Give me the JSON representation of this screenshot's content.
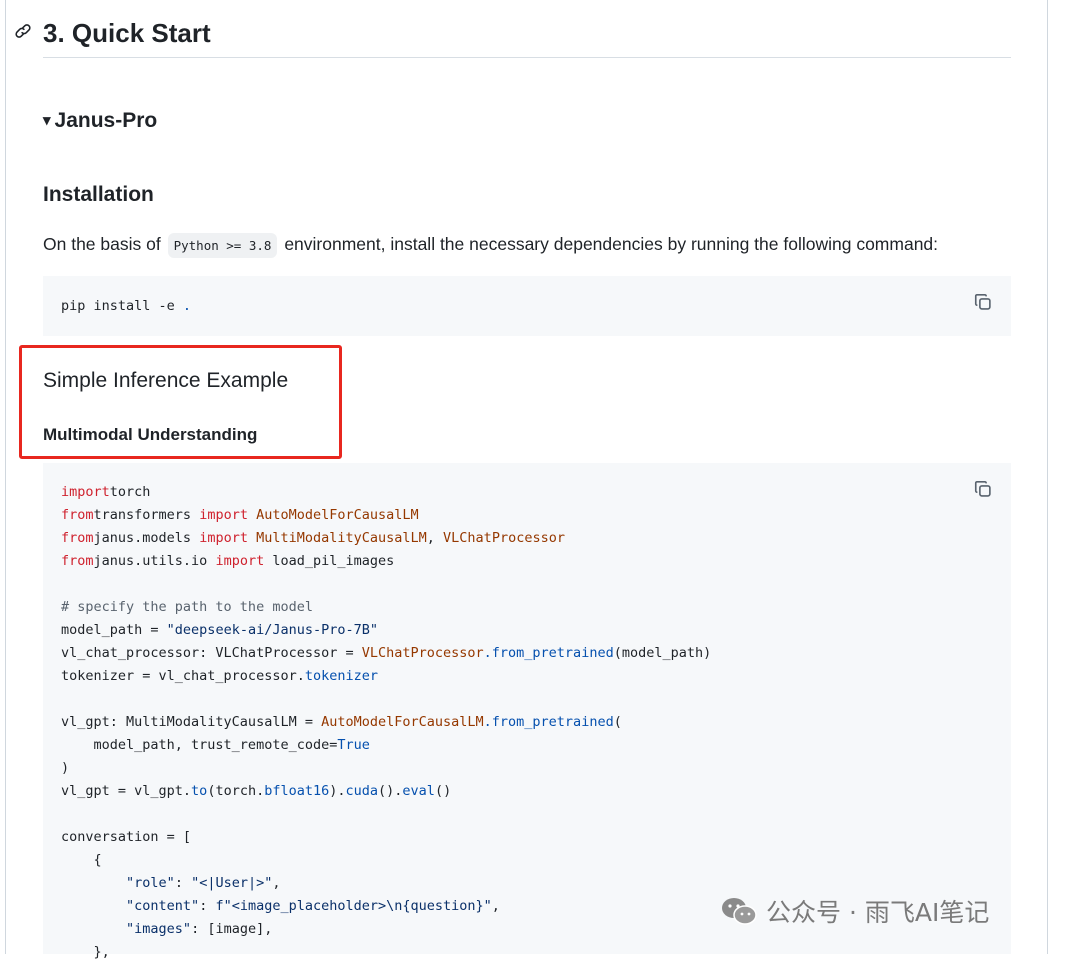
{
  "section": {
    "title": "3. Quick Start",
    "anchor_icon": "link-icon"
  },
  "details": {
    "summary": "Janus-Pro",
    "marker": "▾"
  },
  "installation": {
    "heading": "Installation",
    "text_before": "On the basis of",
    "inline_code": "Python >= 3.8",
    "text_after": "environment, install the necessary dependencies by running the following command:",
    "command_main": "pip install -e ",
    "command_dot": "."
  },
  "inference": {
    "heading": "Simple Inference Example",
    "subheading": "Multimodal Understanding"
  },
  "copy_icon": "copy-icon",
  "highlight_color": "#e8271f",
  "watermark": {
    "text": "公众号 · 雨飞AI笔记",
    "icon": "wechat-icon"
  },
  "code": [
    [
      [
        "kw",
        "import"
      ],
      [
        "",
        "torch"
      ]
    ],
    [
      [
        "kw",
        "from"
      ],
      [
        "",
        "transformers "
      ],
      [
        "kw",
        "import"
      ],
      [
        "nm",
        " AutoModelForCausalLM"
      ]
    ],
    [
      [
        "kw",
        "from"
      ],
      [
        "",
        "janus.models "
      ],
      [
        "kw",
        "import"
      ],
      [
        "nm",
        " MultiModalityCausalLM"
      ],
      [
        "",
        ", "
      ],
      [
        "nm",
        "VLChatProcessor"
      ]
    ],
    [
      [
        "kw",
        "from"
      ],
      [
        "",
        "janus.utils.io "
      ],
      [
        "kw",
        "import"
      ],
      [
        "",
        " load_pil_images"
      ]
    ],
    [],
    [
      [
        "cm",
        "# specify the path to the model"
      ]
    ],
    [
      [
        "",
        "model_path = "
      ],
      [
        "st",
        "\"deepseek-ai/Janus-Pro-7B\""
      ]
    ],
    [
      [
        "",
        "vl_chat_processor: VLChatProcessor = "
      ],
      [
        "nm",
        "VLChatProcessor"
      ],
      [
        "",
        ""
      ],
      [
        "bl",
        ".from_pretrained"
      ],
      [
        "",
        "(model_path)"
      ]
    ],
    [
      [
        "",
        "tokenizer = vl_chat_processor."
      ],
      [
        "bl",
        "tokenizer"
      ]
    ],
    [],
    [
      [
        "",
        "vl_gpt: MultiModalityCausalLM = "
      ],
      [
        "nm",
        "AutoModelForCausalLM"
      ],
      [
        "bl",
        ".from_pretrained"
      ],
      [
        "",
        "("
      ]
    ],
    [
      [
        "",
        "    model_path, trust_remote_code="
      ],
      [
        "bl",
        "True"
      ]
    ],
    [
      [
        "",
        ")"
      ]
    ],
    [
      [
        "",
        "vl_gpt = vl_gpt."
      ],
      [
        "bl",
        "to"
      ],
      [
        "",
        "(torch."
      ],
      [
        "bl",
        "bfloat16"
      ],
      [
        "",
        ")."
      ],
      [
        "bl",
        "cuda"
      ],
      [
        "",
        "()."
      ],
      [
        "bl",
        "eval"
      ],
      [
        "",
        "()"
      ]
    ],
    [],
    [
      [
        "",
        "conversation = ["
      ]
    ],
    [
      [
        "",
        "    {"
      ]
    ],
    [
      [
        "",
        "        "
      ],
      [
        "st",
        "\"role\""
      ],
      [
        "",
        ": "
      ],
      [
        "st",
        "\"<|User|>\""
      ],
      [
        "",
        ","
      ]
    ],
    [
      [
        "",
        "        "
      ],
      [
        "st",
        "\"content\""
      ],
      [
        "",
        ": "
      ],
      [
        "st",
        "f\"<image_placeholder>\\n{question}\""
      ],
      [
        "",
        ","
      ]
    ],
    [
      [
        "",
        "        "
      ],
      [
        "st",
        "\"images\""
      ],
      [
        "",
        ": [image],"
      ]
    ],
    [
      [
        "",
        "    },"
      ]
    ]
  ]
}
